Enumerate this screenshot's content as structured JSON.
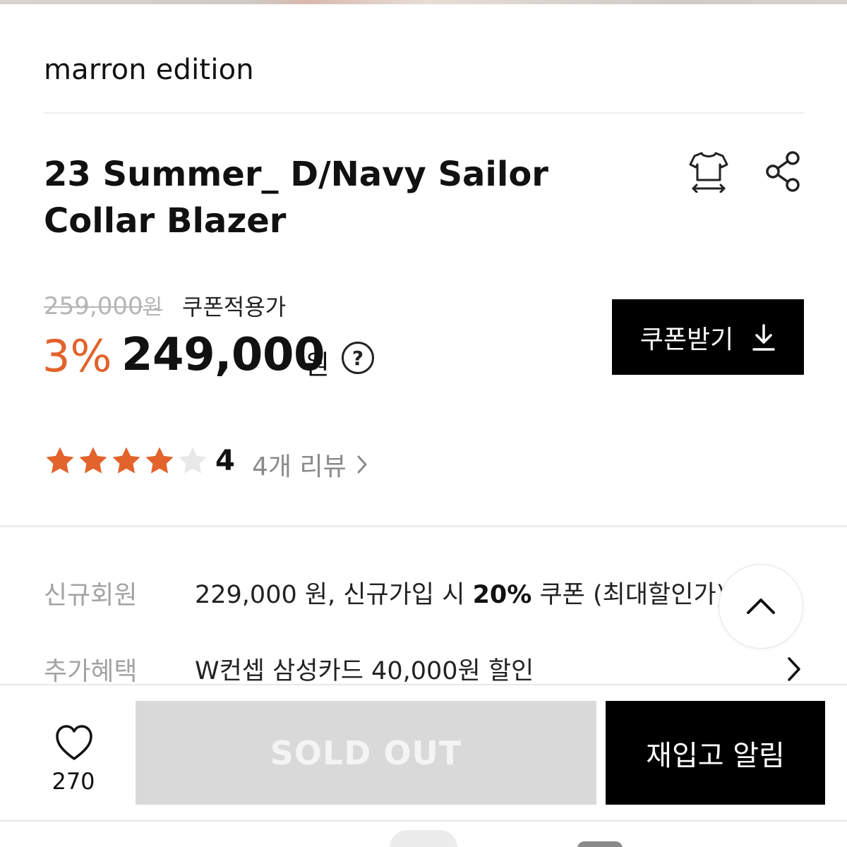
{
  "brand": {
    "name": "marron edition"
  },
  "product": {
    "title": "23 Summer_ D/Navy Sailor Collar Blazer",
    "original_price": "259,000",
    "original_price_unit": "원",
    "coupon_price_label": "쿠폰적용가",
    "discount_rate": "3%",
    "price": "249,000",
    "price_unit": "원",
    "help_symbol": "?"
  },
  "actions": {
    "coupon_button_label": "쿠폰받기",
    "size_guide_icon": "tshirt-size-icon",
    "share_icon": "share-icon",
    "download_icon": "download-icon"
  },
  "rating": {
    "score": "4",
    "score_value": 4,
    "max": 5,
    "review_link_label": "4개 리뷰",
    "star_color": "#e2632b",
    "empty_star_color": "#e8e8e8"
  },
  "benefits": [
    {
      "label": "신규회원",
      "pre": "229,000 원, 신규가입 시 ",
      "bold": "20%",
      "post": " 쿠폰 (최대할인가)"
    },
    {
      "label": "추가혜택",
      "pre": "W컨셉 삼성카드 40,000원 할인",
      "bold": "",
      "post": ""
    }
  ],
  "bottom_bar": {
    "like_count": "270",
    "soldout_label": "SOLD OUT",
    "restock_label": "재입고 알림"
  },
  "colors": {
    "accent_orange": "#e2632b",
    "button_black": "#000000",
    "soldout_gray": "#d9d9d9"
  }
}
